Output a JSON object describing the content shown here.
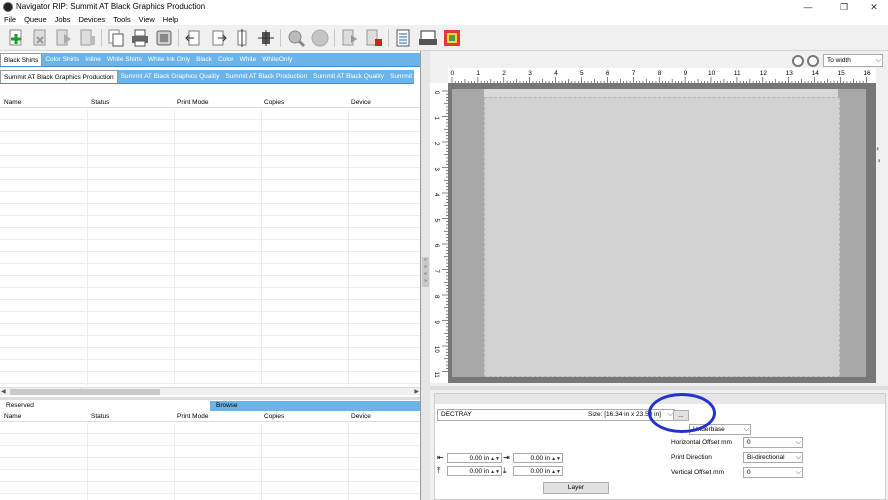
{
  "window": {
    "title": "Navigator RIP: Summit AT Black Graphics Production",
    "minimize": "—",
    "maximize": "❐",
    "close": "✕"
  },
  "menu": [
    "File",
    "Queue",
    "Jobs",
    "Devices",
    "Tools",
    "View",
    "Help"
  ],
  "queue_tabs": [
    "Black Shirts",
    "Color Shirts",
    "Inline",
    "White Shirts",
    "White Ink Only",
    "Black",
    "Color",
    "White",
    "WhiteOnly"
  ],
  "printer_tabs": [
    "Summit AT Black Graphics Production",
    "Summit AT Black Graphics Quality",
    "Summit AT Black Production",
    "Summit AT Black Quality",
    "Summit S"
  ],
  "columns": [
    "Name",
    "Status",
    "Print Mode",
    "Copies",
    "Device"
  ],
  "lower_tabs": {
    "reserved": "Reserved",
    "browse": "Browse"
  },
  "zoom": {
    "value": "To width"
  },
  "ruler_ticks": [
    "0",
    "1",
    "2",
    "3",
    "4",
    "5",
    "6",
    "7",
    "8",
    "9",
    "10",
    "11",
    "12",
    "13",
    "14",
    "15",
    "16"
  ],
  "vruler_ticks": [
    "0",
    "1",
    "2",
    "3",
    "4",
    "5",
    "6",
    "7",
    "8",
    "9",
    "10",
    "11"
  ],
  "media": {
    "name": "DECTRAY",
    "size": "Size: [16.34 in x 23.50 in]",
    "more": "..."
  },
  "underbase": "Underbase",
  "offsets": {
    "left": "0.00 in",
    "right": "0.00 in",
    "top": "0.00 in",
    "bottom": "0.00 in"
  },
  "props": {
    "horizontal_label": "Horizontal Offset mm",
    "horizontal_value": "0",
    "direction_label": "Print Direction",
    "direction_value": "Bi-directional",
    "vertical_label": "Vertical Offset mm",
    "vertical_value": "0"
  },
  "layer_button": "Layer",
  "colors": {
    "tab_blue": "#6ab4ea",
    "annotation": "#2233cc"
  }
}
